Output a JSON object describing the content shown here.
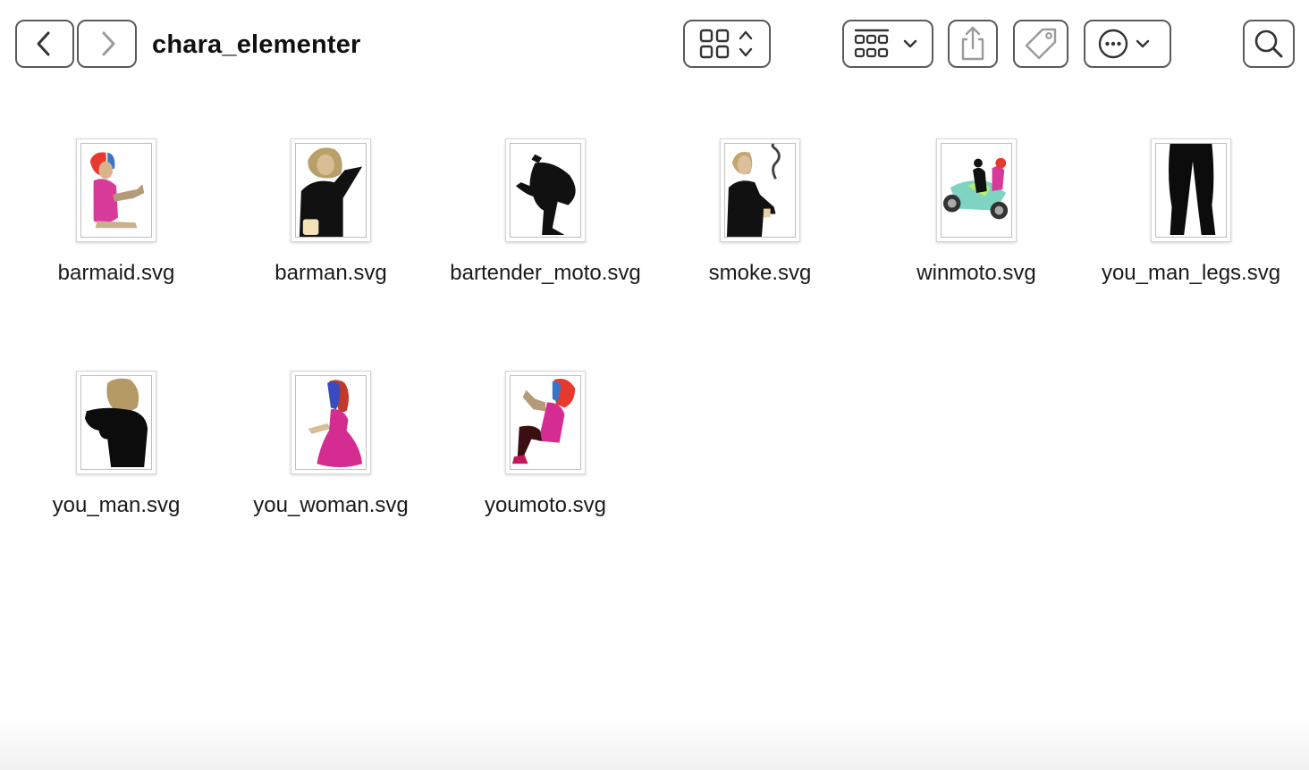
{
  "window": {
    "title": "chara_elementer"
  },
  "toolbar": {
    "back_icon": "chevron-left-icon",
    "forward_icon": "chevron-right-icon",
    "view_icon": "grid-view-icon",
    "group_icon": "group-icon",
    "share_icon": "share-icon",
    "tag_icon": "tag-icon",
    "more_icon": "ellipsis-circle-icon",
    "search_icon": "search-icon"
  },
  "files": [
    {
      "name": "barmaid.svg"
    },
    {
      "name": "barman.svg"
    },
    {
      "name": "bartender_moto.svg"
    },
    {
      "name": "smoke.svg"
    },
    {
      "name": "winmoto.svg"
    },
    {
      "name": "you_man_legs.svg"
    },
    {
      "name": "you_man.svg"
    },
    {
      "name": "you_woman.svg"
    },
    {
      "name": "youmoto.svg"
    }
  ]
}
